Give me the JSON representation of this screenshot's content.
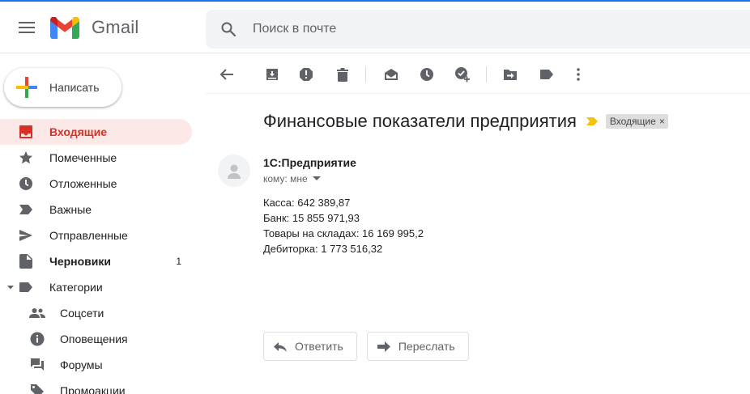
{
  "app": {
    "name": "Gmail"
  },
  "search": {
    "placeholder": "Поиск в почте"
  },
  "compose": {
    "label": "Написать"
  },
  "sidebar": {
    "items": [
      {
        "label": "Входящие",
        "icon": "inbox-icon",
        "active": true
      },
      {
        "label": "Помеченные",
        "icon": "star-icon"
      },
      {
        "label": "Отложенные",
        "icon": "clock-icon"
      },
      {
        "label": "Важные",
        "icon": "important-icon"
      },
      {
        "label": "Отправленные",
        "icon": "send-icon"
      },
      {
        "label": "Черновики",
        "icon": "draft-icon",
        "count": "1"
      },
      {
        "label": "Категории",
        "icon": "label-icon",
        "expanded": true
      }
    ],
    "categories": [
      {
        "label": "Соцсети",
        "icon": "people-icon"
      },
      {
        "label": "Оповещения",
        "icon": "info-icon"
      },
      {
        "label": "Форумы",
        "icon": "forum-icon"
      },
      {
        "label": "Промоакции",
        "icon": "tag-icon"
      }
    ]
  },
  "toolbar": {
    "buttons": [
      "back-arrow-icon",
      "archive-icon",
      "report-spam-icon",
      "delete-icon",
      "mark-unread-icon",
      "snooze-icon",
      "add-task-icon",
      "move-to-icon",
      "labels-icon",
      "more-icon"
    ]
  },
  "message": {
    "subject": "Финансовые показатели предприятия",
    "label_chip": "Входящие",
    "label_chip_close": "×",
    "sender": "1С:Предприятие",
    "to": "кому: мне",
    "body_lines": [
      "Касса: 642 389,87",
      "Банк: 15 855 971,93",
      "Товары на складах: 16 169 995,2",
      "Дебиторка: 1 773 516,32"
    ]
  },
  "actions": {
    "reply": "Ответить",
    "forward": "Переслать"
  },
  "colors": {
    "accent_red": "#d93025",
    "active_bg": "#fce8e6",
    "importance_yellow": "#f4c20d",
    "icon_grey": "#5f6368"
  }
}
